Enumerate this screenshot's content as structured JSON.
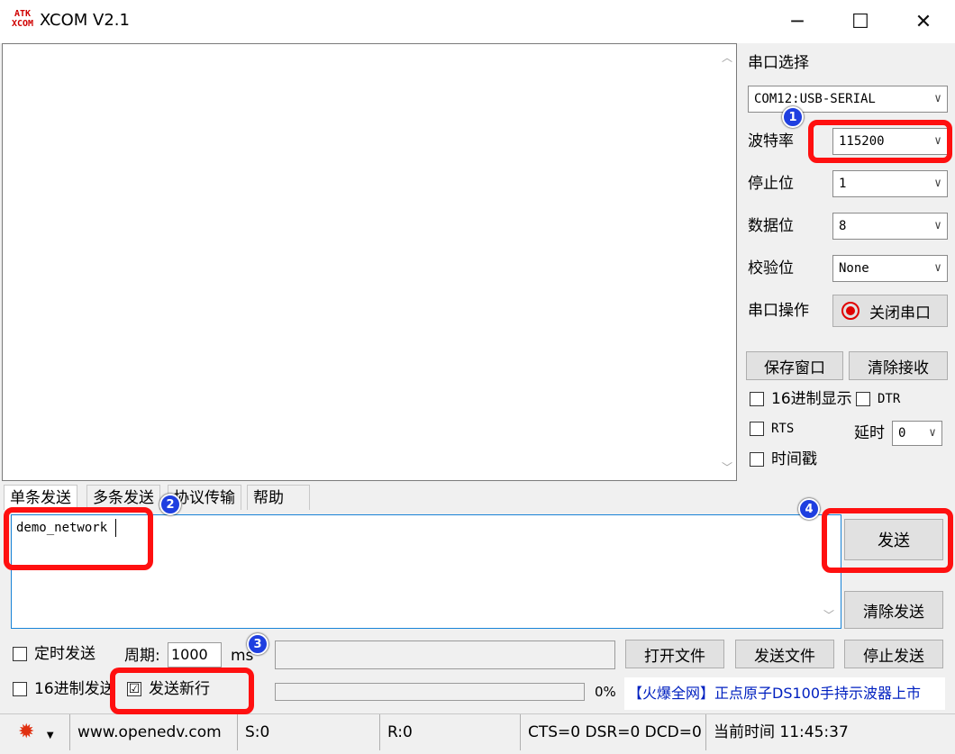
{
  "window": {
    "logo_top": "ATK",
    "logo_bottom": "XCOM",
    "title": "XCOM V2.1",
    "minimize": "─",
    "maximize": "☐",
    "close": "✕"
  },
  "serial": {
    "section_label": "串口选择",
    "port_value": "COM12:USB-SERIAL",
    "baud_label": "波特率",
    "baud_value": "115200",
    "stop_label": "停止位",
    "stop_value": "1",
    "data_label": "数据位",
    "data_value": "8",
    "parity_label": "校验位",
    "parity_value": "None",
    "op_label": "串口操作",
    "op_button": "关闭串口"
  },
  "receive_controls": {
    "save_window": "保存窗口",
    "clear_receive": "清除接收",
    "hex_display": "16进制显示",
    "dtr": "DTR",
    "rts": "RTS",
    "delay_label": "延时",
    "delay_value": "0",
    "timestamp": "时间戳"
  },
  "tabs": [
    "单条发送",
    "多条发送",
    "协议传输",
    "帮助"
  ],
  "send": {
    "text": "demo_network",
    "send_button": "发送",
    "clear_send": "清除发送",
    "timed_send": "定时发送",
    "period_label": "周期:",
    "period_value": "1000",
    "period_unit": "ms",
    "open_file": "打开文件",
    "send_file": "发送文件",
    "stop_send": "停止发送",
    "hex_send": "16进制发送",
    "send_newline": "发送新行",
    "send_newline_checked": "☑",
    "progress": "0%",
    "progress_value": 0,
    "ad": "【火爆全网】正点原子DS100手持示波器上市"
  },
  "status": {
    "site": "www.openedv.com",
    "sent": "S:0",
    "received": "R:0",
    "lines": "CTS=0 DSR=0 DCD=0",
    "time": "当前时间 11:45:37"
  },
  "annotations": {
    "b1": "1",
    "b2": "2",
    "b3": "3",
    "b4": "4"
  },
  "colors": {
    "annotation": "#ff1010",
    "badge": "#1f3fe0",
    "ad_text": "#0020c0",
    "focus_border": "#1883d7"
  }
}
